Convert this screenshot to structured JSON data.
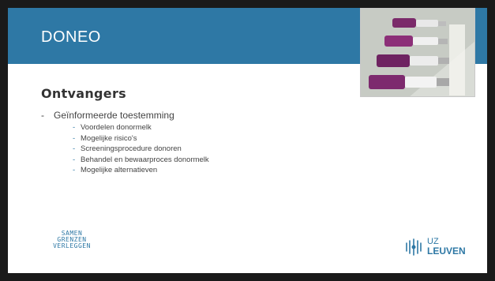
{
  "header": {
    "title": "DONEO"
  },
  "content": {
    "heading": "Ontvangers",
    "bullet": {
      "dash": "-",
      "text": "Geïnformeerde toestemming"
    },
    "sub_items": [
      "Voordelen donormelk",
      "Mogelijke risico's",
      "Screeningsprocedure donoren",
      "Behandel en bewaarproces donormelk",
      "Mogelijke alternatieven"
    ],
    "sub_dash": "-"
  },
  "footer": {
    "left_logo": {
      "line1": "SAMEN",
      "line2": "GRENZEN",
      "line3": "VERLEGGEN"
    },
    "right_logo": {
      "line1": "UZ",
      "line2": "LEUVEN"
    }
  },
  "colors": {
    "accent": "#2e78a5",
    "frame": "#1a1a1a",
    "text": "#444444"
  }
}
